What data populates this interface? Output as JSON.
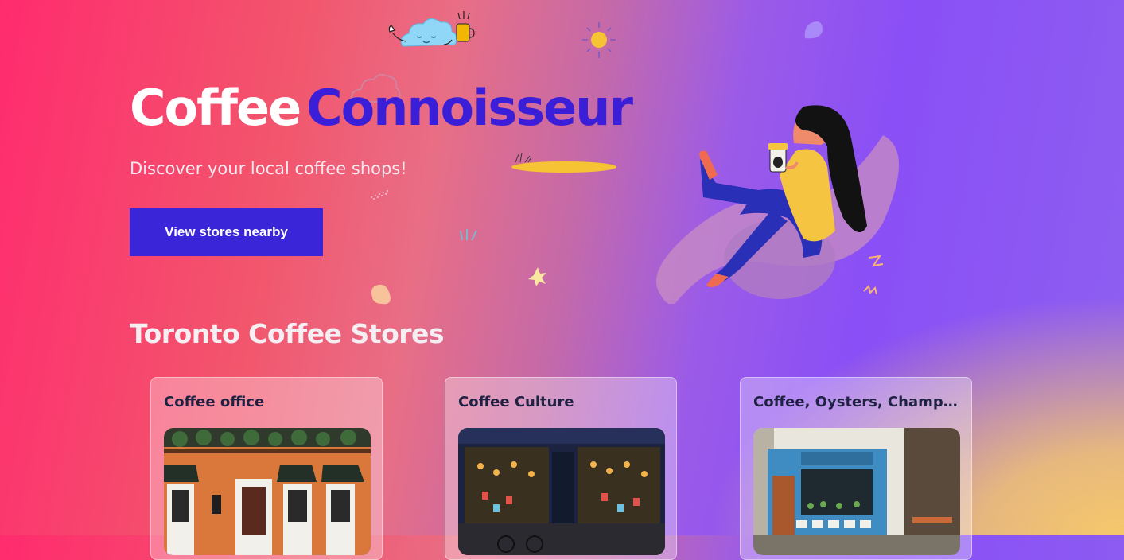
{
  "hero": {
    "title_part_1": "Coffee",
    "title_part_2": "Connoisseur",
    "subtitle": "Discover your local coffee shops!",
    "cta_label": "View stores nearby"
  },
  "section": {
    "title": "Toronto Coffee Stores"
  },
  "stores": [
    {
      "name": "Coffee office",
      "image_icon": "storefront-orange-image"
    },
    {
      "name": "Coffee Culture",
      "image_icon": "storefront-navy-image"
    },
    {
      "name": "Coffee, Oysters, Champagne",
      "image_icon": "storefront-blue-image"
    }
  ],
  "colors": {
    "accent": "#3b25d8",
    "title_accent": "#3b1fd8",
    "gradient_left": "#ff2b6e",
    "gradient_right": "#8a4ff6",
    "gradient_corner": "#f6c86a"
  }
}
